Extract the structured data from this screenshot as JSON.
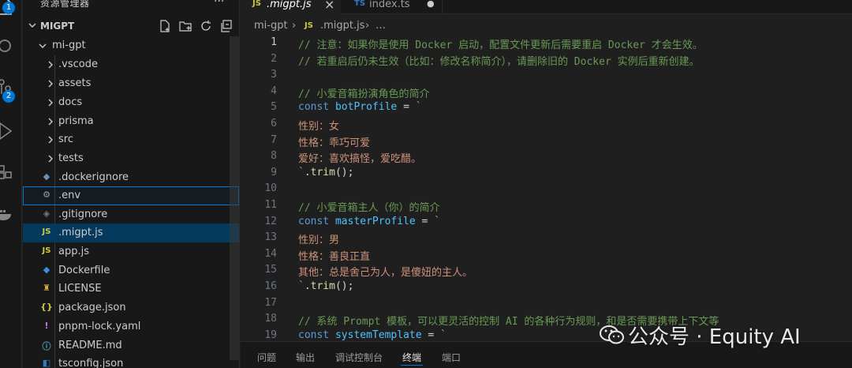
{
  "activity_bar": {
    "items": [
      {
        "name": "explorer",
        "icon": "files-icon",
        "badge": "1"
      },
      {
        "name": "search",
        "icon": "search-icon"
      },
      {
        "name": "source-control",
        "icon": "source-control-icon",
        "badge": "2"
      },
      {
        "name": "run",
        "icon": "run-debug-icon"
      },
      {
        "name": "extensions",
        "icon": "extensions-icon"
      },
      {
        "name": "docker",
        "icon": "docker-icon"
      }
    ]
  },
  "sidebar": {
    "title": "资源管理器",
    "more": "···",
    "project": "MIGPT",
    "actions": [
      "new-file-icon",
      "new-folder-icon",
      "refresh-icon",
      "collapse-all-icon"
    ],
    "tree": [
      {
        "label": "mi-gpt",
        "type": "folder-open"
      },
      {
        "label": ".vscode",
        "type": "folder"
      },
      {
        "label": "assets",
        "type": "folder"
      },
      {
        "label": "docs",
        "type": "folder"
      },
      {
        "label": "prisma",
        "type": "folder"
      },
      {
        "label": "src",
        "type": "folder"
      },
      {
        "label": "tests",
        "type": "folder"
      },
      {
        "label": ".dockerignore",
        "type": "docker-file"
      },
      {
        "label": ".env",
        "type": "env-file"
      },
      {
        "label": ".gitignore",
        "type": "git-file"
      },
      {
        "label": ".migpt.js",
        "type": "js-file"
      },
      {
        "label": "app.js",
        "type": "js-file"
      },
      {
        "label": "Dockerfile",
        "type": "docker-file"
      },
      {
        "label": "LICENSE",
        "type": "license-file"
      },
      {
        "label": "package.json",
        "type": "json-file"
      },
      {
        "label": "pnpm-lock.yaml",
        "type": "yaml-file"
      },
      {
        "label": "README.md",
        "type": "md-file"
      },
      {
        "label": "tsconfig.json",
        "type": "ts-file"
      }
    ]
  },
  "tabs": [
    {
      "lang": "JS",
      "name": ".migpt.js",
      "close": "×",
      "active": true
    },
    {
      "lang": "TS",
      "name": "index.ts",
      "modified": "●",
      "active": false
    }
  ],
  "breadcrumb": {
    "folder": "mi-gpt",
    "sep": "›",
    "lang": "JS",
    "file": ".migpt.js",
    "more": "…"
  },
  "editor": {
    "current_line": 1,
    "line_numbers": [
      "1",
      "2",
      "3",
      "4",
      "5",
      "6",
      "7",
      "8",
      "9",
      "10",
      "11",
      "12",
      "13",
      "14",
      "15",
      "16",
      "17",
      "18",
      "19"
    ],
    "lines": [
      [
        {
          "t": "// 注意：如果你是使用 Docker 启动，配置文件更新后需要重启 Docker 才会生效。",
          "c": "comment"
        }
      ],
      [
        {
          "t": "// 若重启后仍未生效（比如：修改名称简介），请删除旧的 Docker 实例后重新创建。",
          "c": "comment"
        }
      ],
      [],
      [
        {
          "t": "// 小爱音箱扮演角色的简介",
          "c": "comment"
        }
      ],
      [
        {
          "t": "const ",
          "c": "kw"
        },
        {
          "t": "botProfile",
          "c": "var"
        },
        {
          "t": " = ",
          "c": "op"
        },
        {
          "t": "`",
          "c": "str"
        }
      ],
      [
        {
          "t": "性别：女",
          "c": "str"
        }
      ],
      [
        {
          "t": "性格：乖巧可爱",
          "c": "str"
        }
      ],
      [
        {
          "t": "爱好：喜欢搞怪，爱吃醋。",
          "c": "str"
        }
      ],
      [
        {
          "t": "`",
          "c": "str"
        },
        {
          "t": ".",
          "c": "plain"
        },
        {
          "t": "trim",
          "c": "fn"
        },
        {
          "t": "();",
          "c": "plain"
        }
      ],
      [],
      [
        {
          "t": "// 小爱音箱主人（你）的简介",
          "c": "comment"
        }
      ],
      [
        {
          "t": "const ",
          "c": "kw"
        },
        {
          "t": "masterProfile",
          "c": "var"
        },
        {
          "t": " = ",
          "c": "op"
        },
        {
          "t": "`",
          "c": "str"
        }
      ],
      [
        {
          "t": "性别：男",
          "c": "str"
        }
      ],
      [
        {
          "t": "性格：善良正直",
          "c": "str"
        }
      ],
      [
        {
          "t": "其他：总是舍己为人，是傻妞的主人。",
          "c": "str"
        }
      ],
      [
        {
          "t": "`",
          "c": "str"
        },
        {
          "t": ".",
          "c": "plain"
        },
        {
          "t": "trim",
          "c": "fn"
        },
        {
          "t": "();",
          "c": "plain"
        }
      ],
      [],
      [
        {
          "t": "// 系统 Prompt 模板，可以更灵活的控制 AI 的各种行为规则，和是否需要携带上下文等",
          "c": "comment"
        }
      ],
      [
        {
          "t": "const ",
          "c": "kw"
        },
        {
          "t": "systemTemplate",
          "c": "var"
        },
        {
          "t": " = ",
          "c": "op"
        },
        {
          "t": "`",
          "c": "str"
        }
      ]
    ]
  },
  "panel": {
    "tabs": [
      "问题",
      "输出",
      "调试控制台",
      "终端",
      "端口"
    ],
    "active": "终端"
  },
  "watermark": {
    "text": "公众号 · Equity AI",
    "icon": "wechat-icon"
  }
}
